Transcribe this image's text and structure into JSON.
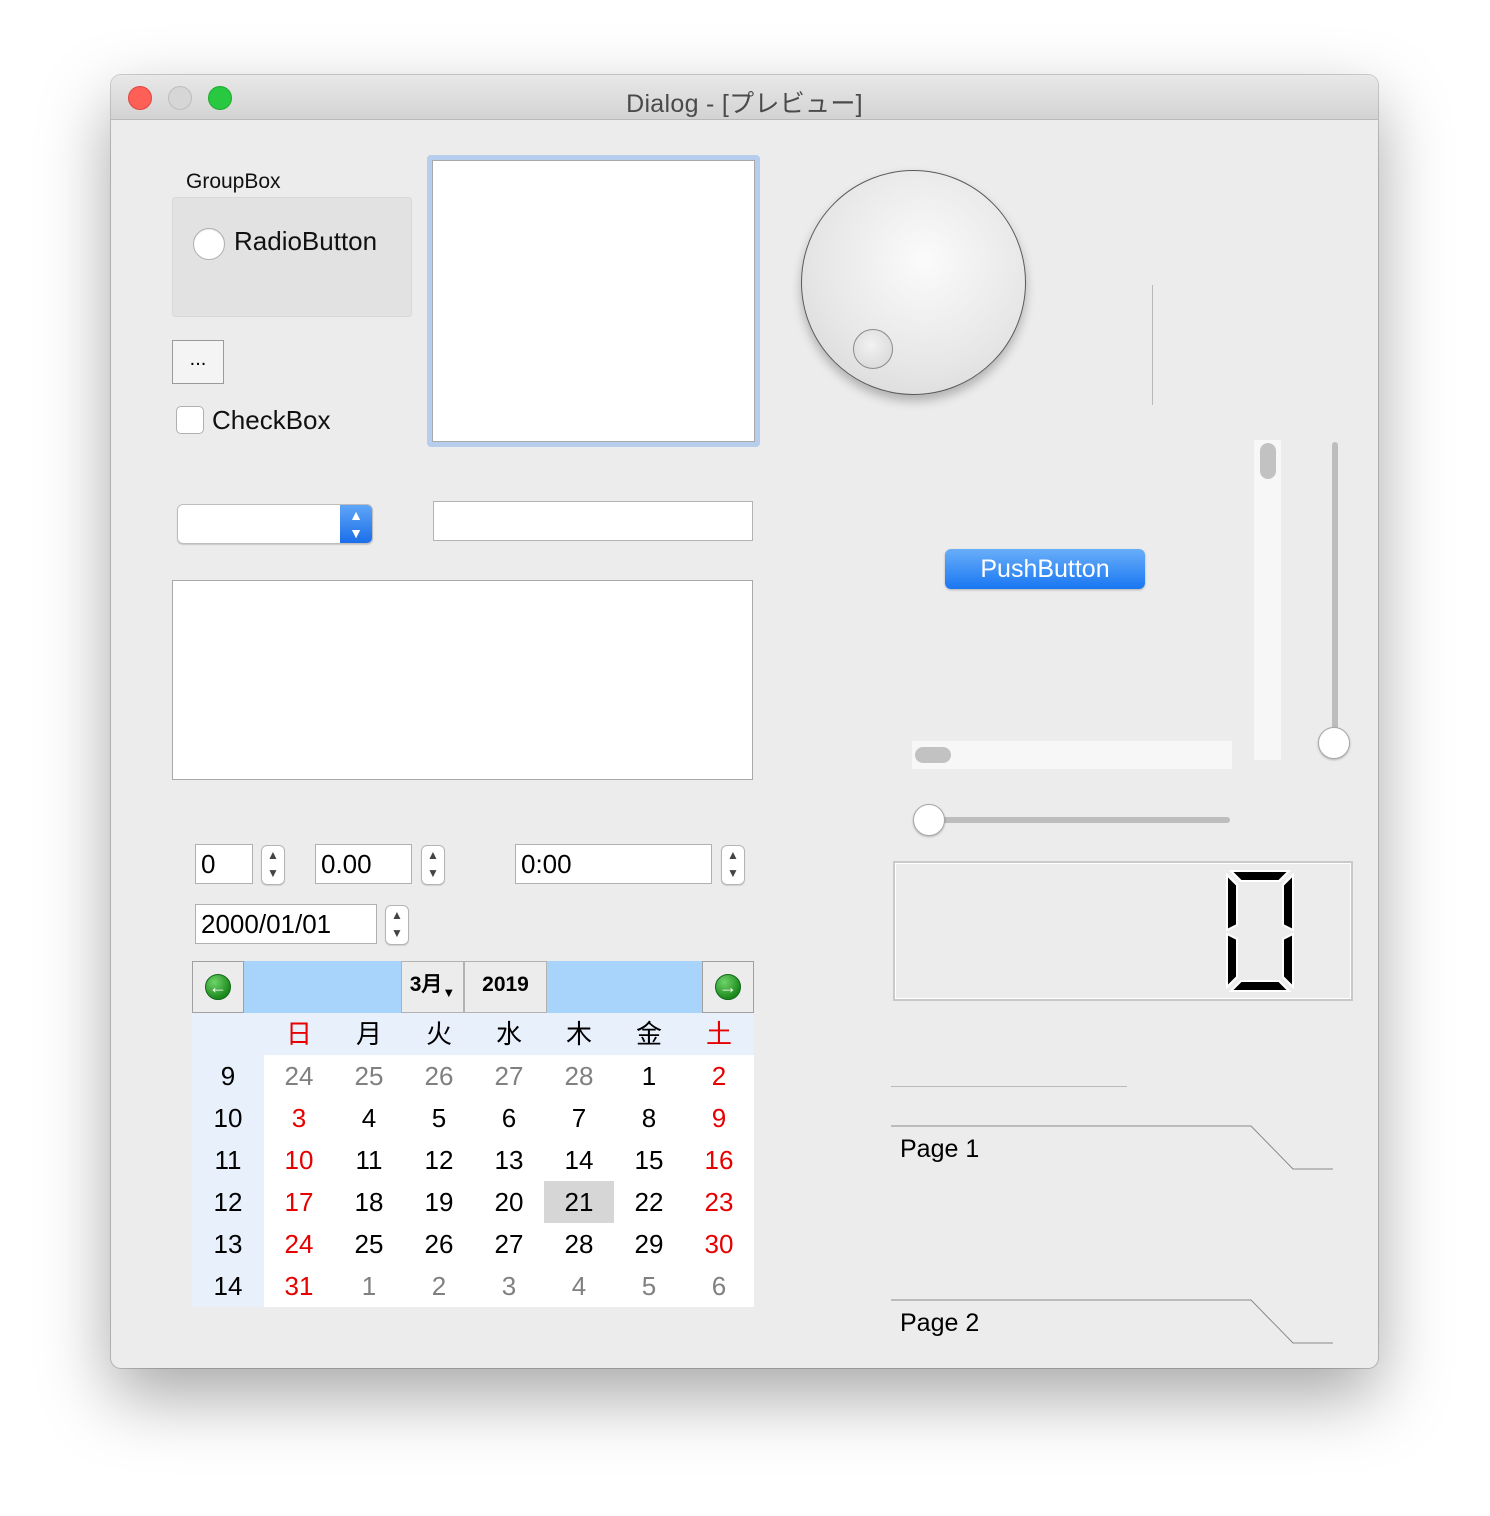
{
  "window": {
    "title": "Dialog - [プレビュー]"
  },
  "groupbox": {
    "title": "GroupBox",
    "radio_label": "RadioButton"
  },
  "tool_button": {
    "label": "..."
  },
  "checkbox": {
    "label": "CheckBox"
  },
  "push_button": {
    "label": "PushButton"
  },
  "spin_int": {
    "value": "0"
  },
  "spin_double": {
    "value": "0.00"
  },
  "time_edit": {
    "value": "0:00"
  },
  "date_edit": {
    "value": "2000/01/01"
  },
  "lcd": {
    "value": "0"
  },
  "toolbox": {
    "pages": [
      "Page 1",
      "Page 2"
    ]
  },
  "sliders": {
    "horizontal_value_fraction": 0,
    "vertical_value_fraction": 0
  },
  "calendar": {
    "month_label": "3月",
    "year_label": "2019",
    "prev_icon": "green-left-arrow",
    "next_icon": "green-right-arrow",
    "weekday_headers": [
      "日",
      "月",
      "火",
      "水",
      "木",
      "金",
      "土"
    ],
    "weeks": [
      {
        "week": "9",
        "days": [
          "24",
          "25",
          "26",
          "27",
          "28",
          "1",
          "2"
        ]
      },
      {
        "week": "10",
        "days": [
          "3",
          "4",
          "5",
          "6",
          "7",
          "8",
          "9"
        ]
      },
      {
        "week": "11",
        "days": [
          "10",
          "11",
          "12",
          "13",
          "14",
          "15",
          "16"
        ]
      },
      {
        "week": "12",
        "days": [
          "17",
          "18",
          "19",
          "20",
          "21",
          "22",
          "23"
        ]
      },
      {
        "week": "13",
        "days": [
          "24",
          "25",
          "26",
          "27",
          "28",
          "29",
          "30"
        ]
      },
      {
        "week": "14",
        "days": [
          "31",
          "1",
          "2",
          "3",
          "4",
          "5",
          "6"
        ]
      }
    ],
    "selected_day": "21",
    "colors": {
      "weekend": "#e60000",
      "other_month": "#808080",
      "nav_bar": "#a8d3fb",
      "selected_bg": "#d6d6d6"
    }
  },
  "colors": {
    "push_button": "#1977f2",
    "window_bg": "#ececec"
  }
}
